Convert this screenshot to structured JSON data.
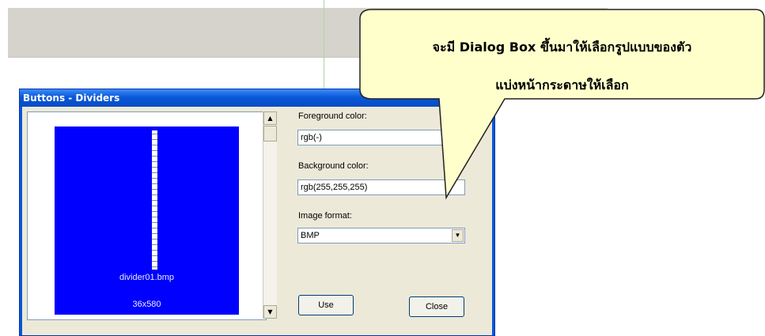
{
  "dialog": {
    "title": "Buttons - Dividers",
    "preview": {
      "file_name": "divider01.bmp",
      "dimensions": "36x580",
      "background_color": "#0000ff"
    },
    "foreground_label": "Foreground color:",
    "foreground_value": "rgb(-)",
    "background_label": "Background color:",
    "background_value": "rgb(255,255,255)",
    "format_label": "Image format:",
    "format_value": "BMP",
    "use_label": "Use",
    "close_label": "Close"
  },
  "callout": {
    "line1": "จะมี Dialog Box ขึ้นมาให้เลือกรูปแบบของตัว",
    "line2": "แบ่งหน้ากระดาษให้เลือก",
    "fill_color": "#ffffcc",
    "border_color": "#222222"
  }
}
